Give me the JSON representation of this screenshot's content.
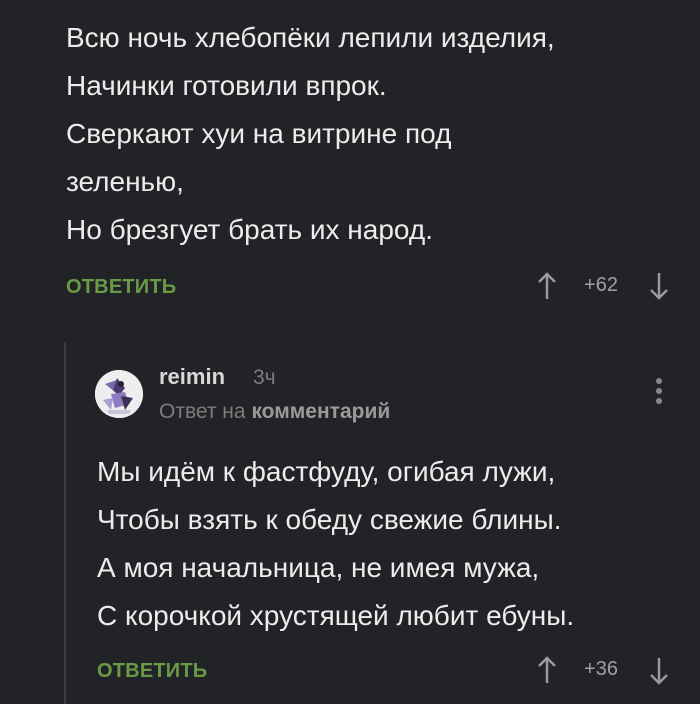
{
  "parent_comment": {
    "lines": [
      "Всю ночь хлебопёки лепили изделия,",
      "Начинки готовили впрок.",
      "Сверкают хуи на витрине под",
      "зеленью,",
      "Но брезгует брать их народ."
    ],
    "reply_label": "ОТВЕТИТЬ",
    "rating": "+62"
  },
  "reply_comment": {
    "username": "reimin",
    "time": "3ч",
    "reply_to_prefix": "Ответ на",
    "reply_to_target": "комментарий",
    "lines": [
      "Мы идём к фастфуду, огибая лужи,",
      "Чтобы взять к обеду свежие блины.",
      "А моя начальница, не имея мужа,",
      "С корочкой хрустящей любит ебуны."
    ],
    "reply_label": "ОТВЕТИТЬ",
    "rating": "+36"
  },
  "icons": {
    "upvote": "arrow-up-icon",
    "downvote": "arrow-down-icon",
    "more": "more-vertical-icon"
  },
  "colors": {
    "background": "#222327",
    "text": "#ececec",
    "accent_green": "#6a9a45",
    "muted": "#7c7c7c"
  }
}
